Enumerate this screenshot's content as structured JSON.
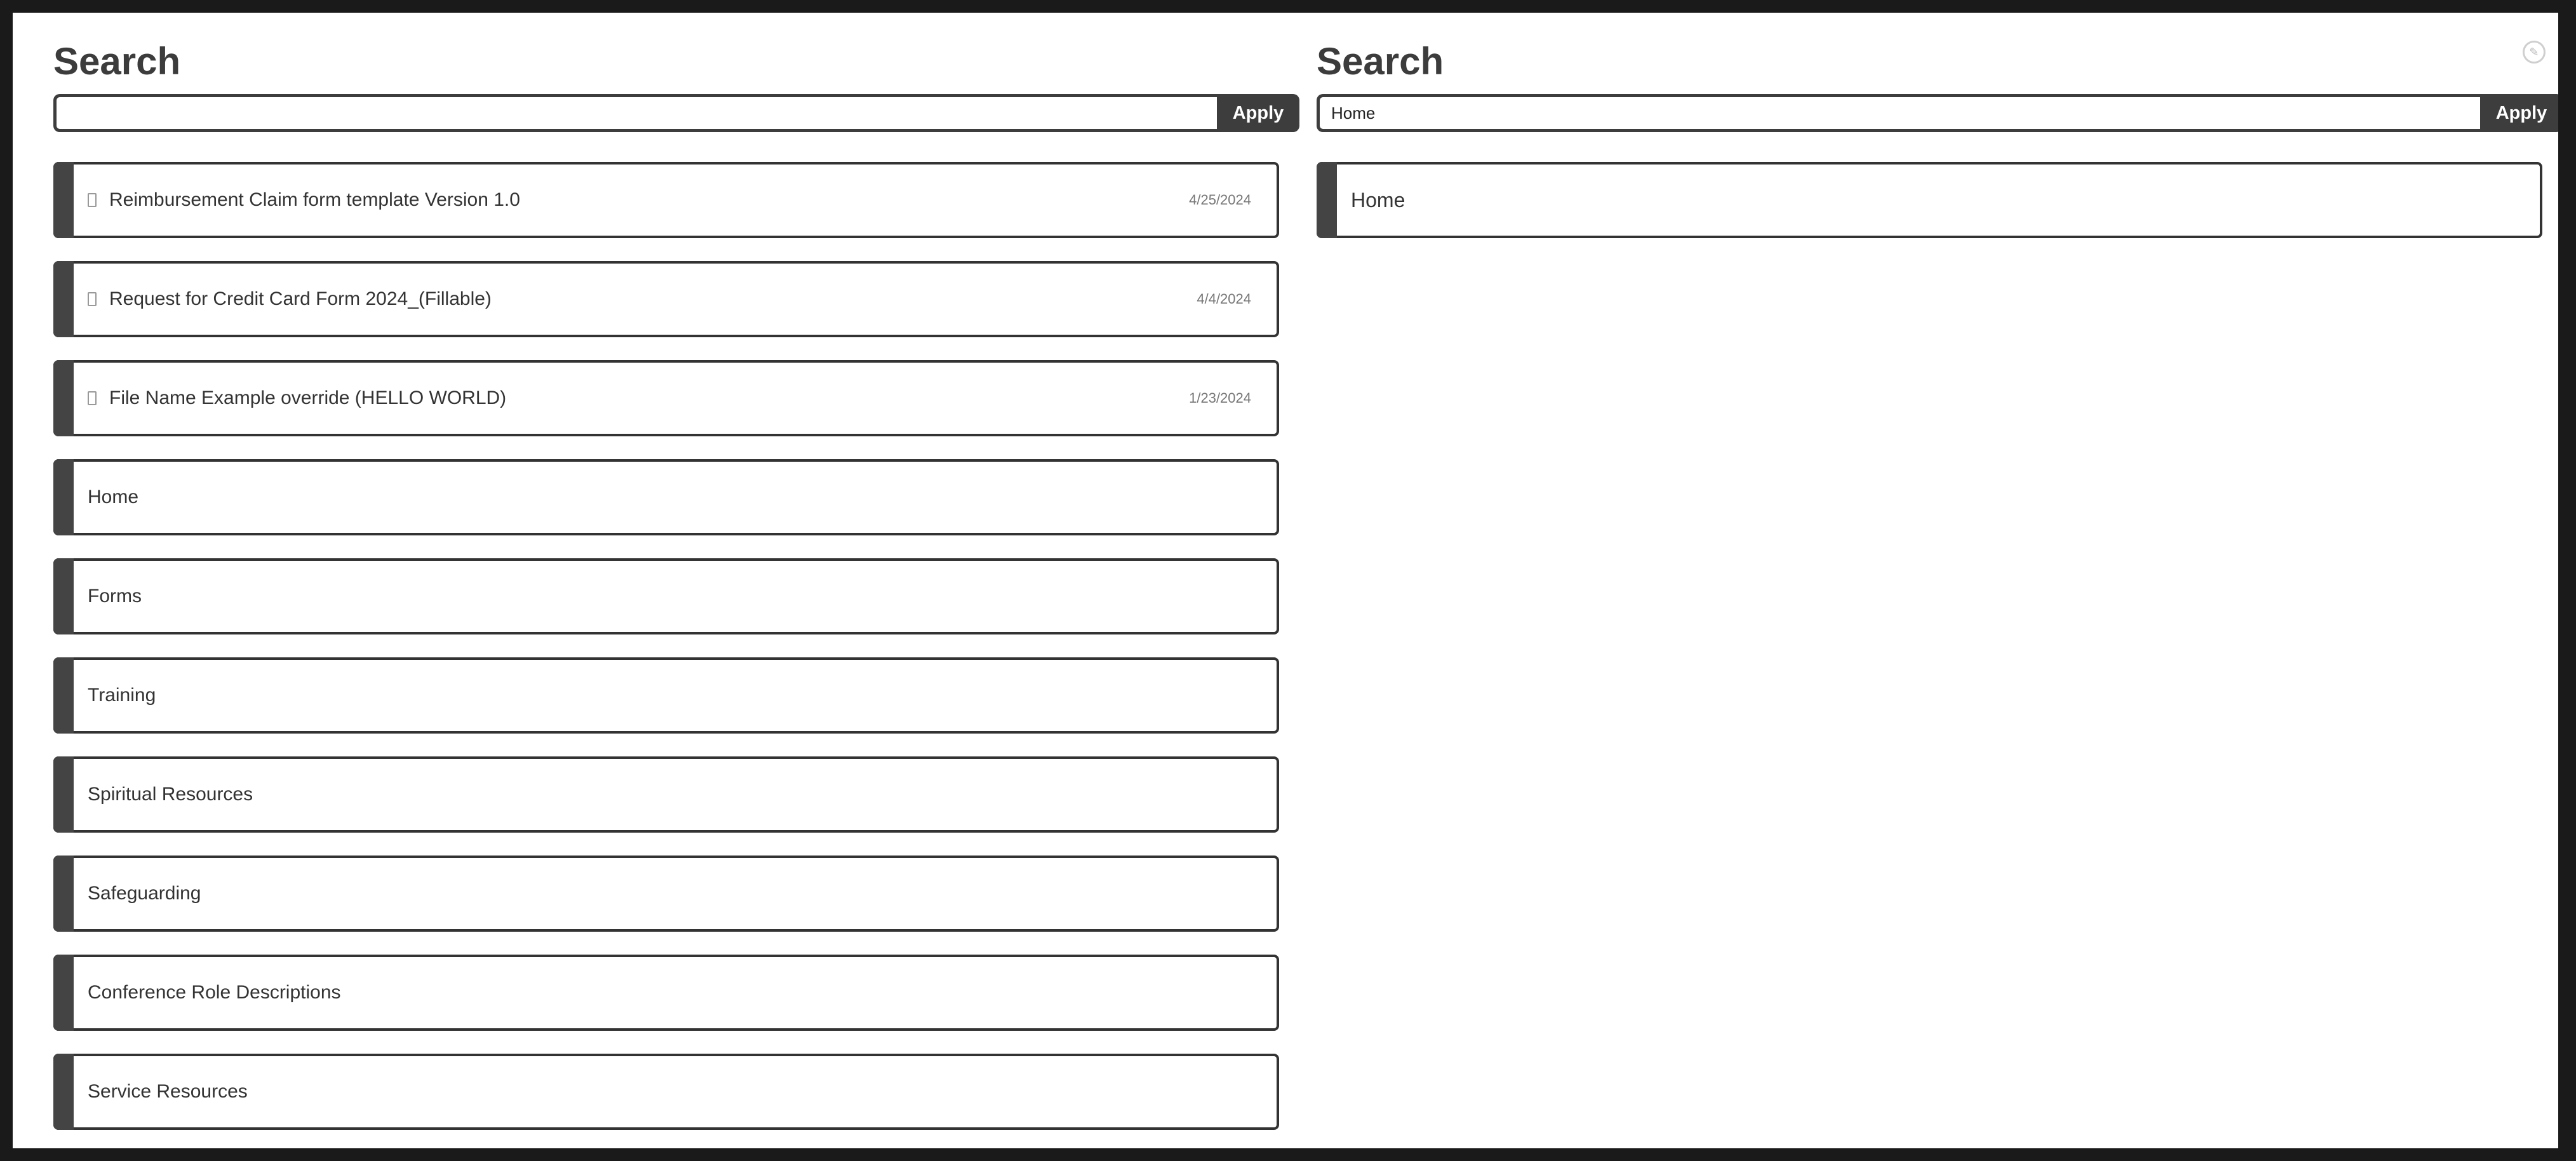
{
  "left": {
    "title": "Search",
    "search": {
      "value": "",
      "placeholder": ""
    },
    "apply_label": "Apply",
    "files": [
      {
        "label": "Reimbursement Claim form template Version 1.0",
        "date": "4/25/2024"
      },
      {
        "label": "Request for Credit Card Form 2024_(Fillable)",
        "date": "4/4/2024"
      },
      {
        "label": "File Name Example override (HELLO WORLD)",
        "date": "1/23/2024"
      }
    ],
    "pages": [
      {
        "label": "Home"
      },
      {
        "label": "Forms"
      },
      {
        "label": "Training"
      },
      {
        "label": "Spiritual Resources"
      },
      {
        "label": "Safeguarding"
      },
      {
        "label": "Conference Role Descriptions"
      },
      {
        "label": "Service Resources"
      }
    ]
  },
  "right": {
    "title": "Search",
    "search": {
      "value": "Home",
      "placeholder": ""
    },
    "apply_label": "Apply",
    "results": [
      {
        "label": "Home"
      }
    ]
  },
  "icons": {
    "file": "document-icon",
    "edit": "pencil-icon"
  },
  "colors": {
    "accent": "#444444",
    "button": "#3d3d3d",
    "background": "#ffffff"
  }
}
